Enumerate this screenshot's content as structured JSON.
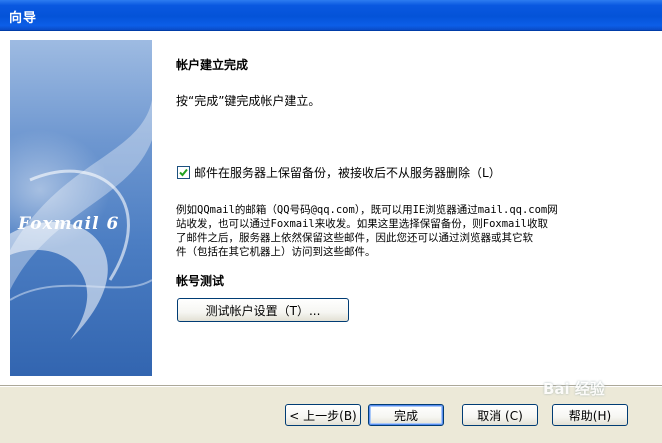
{
  "window": {
    "title": "向导"
  },
  "sidebar": {
    "logo_text": "Foxmail 6"
  },
  "main": {
    "heading": "帐户建立完成",
    "instruction": "按“完成”键完成帐户建立。",
    "checkbox": {
      "checked": true,
      "label": "邮件在服务器上保留备份，被接收后不从服务器删除（L）"
    },
    "description": [
      "例如QQmail的邮箱（QQ号码@qq.com），既可以用IE浏览器通过mail.qq.com网",
      "站收发，也可以通过Foxmail来收发。如果这里选择保留备份，则Foxmail收取",
      "了邮件之后，服务器上依然保留这些邮件，因此您还可以通过浏览器或其它软",
      "件（包括在其它机器上）访问到这些邮件。"
    ],
    "test_heading": "帐号测试",
    "test_button": "测试帐户设置（T）..."
  },
  "footer": {
    "back_button": "< 上一步(B)",
    "finish_button": "完成",
    "cancel_button": "取消 (C)",
    "help_button": "帮助(H)"
  },
  "watermark": "Bai 经验",
  "colors": {
    "titlebar": "#0453d8",
    "dialog_bg": "#ece9d8",
    "check": "#21a121"
  }
}
